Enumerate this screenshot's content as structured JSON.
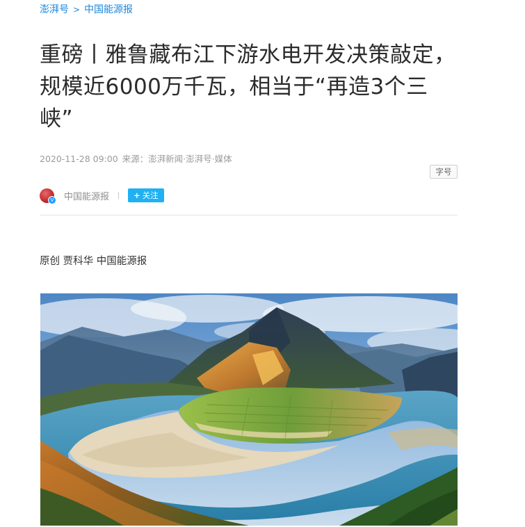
{
  "breadcrumb": {
    "home": "澎湃号",
    "separator": ">",
    "channel": "中国能源报"
  },
  "article": {
    "title": "重磅丨雅鲁藏布江下游水电开发决策敲定，规模近6000万千瓦，相当于“再造3个三峡”",
    "datetime": "2020-11-28 09:00",
    "source_label": "来源：",
    "source": "澎湃新闻·澎湃号·媒体",
    "font_size_button": "字号",
    "byline": "原创 贾科华 中国能源报"
  },
  "author": {
    "name": "中国能源报",
    "verified_badge": "V",
    "follow_plus": "+",
    "follow_label": "关注"
  },
  "colors": {
    "link": "#1b86d8",
    "follow_button": "#1fb1f3",
    "title": "#2b2b2b",
    "meta": "#9a9a9a"
  },
  "icons": {
    "avatar": "author-avatar",
    "verified": "verified-badge-icon"
  }
}
